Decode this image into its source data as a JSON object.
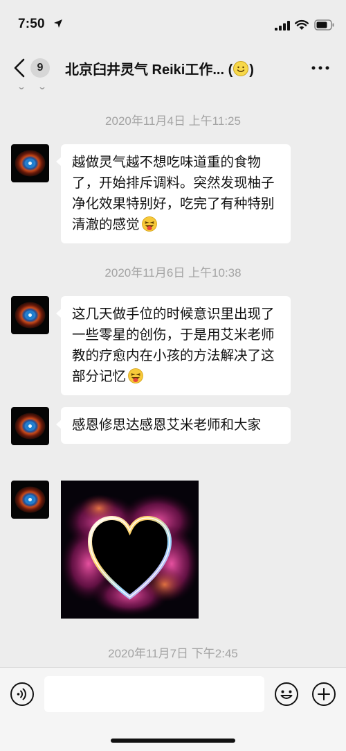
{
  "status_bar": {
    "time": "7:50",
    "icons": [
      "location-arrow-icon",
      "signal-icon",
      "wifi-icon",
      "battery-icon"
    ]
  },
  "header": {
    "back_icon": "chevron-left-icon",
    "unread_count": "9",
    "title": "北京臼井灵气 Reiki工作...",
    "title_suffix_open": " (",
    "title_suffix_close": ")",
    "title_emoji": "smiley-emoji",
    "more_icon": "ellipsis-icon"
  },
  "messages": [
    {
      "timestamp": "2020年11月4日 上午11:25",
      "text": "越做灵气越不想吃味道重的食物了，开始排斥调料。突然发现柚子净化效果特别好，吃完了有种特别清澈的感觉",
      "emoji": "tongue-wink-emoji"
    },
    {
      "timestamp": "2020年11月6日 上午10:38",
      "text": "这几天做手位的时候意识里出现了一些零星的创伤，于是用艾米老师教的疗愈内在小孩的方法解决了这部分记忆",
      "emoji": "tongue-wink-emoji"
    },
    {
      "text": "感恩修思达感恩艾米老师和大家"
    },
    {
      "image": "glowing-heart-image"
    },
    {
      "timestamp": "2020年11月7日 下午2:45"
    }
  ],
  "avatar": "nebula-eye-avatar",
  "input_bar": {
    "voice_icon": "voice-icon",
    "input_value": "",
    "emoji_icon": "emoji-icon",
    "plus_icon": "plus-icon"
  },
  "colors": {
    "background": "#ededed",
    "bubble": "#ffffff",
    "timestamp": "#a3a3a3",
    "input_bar": "#f5f5f5"
  }
}
